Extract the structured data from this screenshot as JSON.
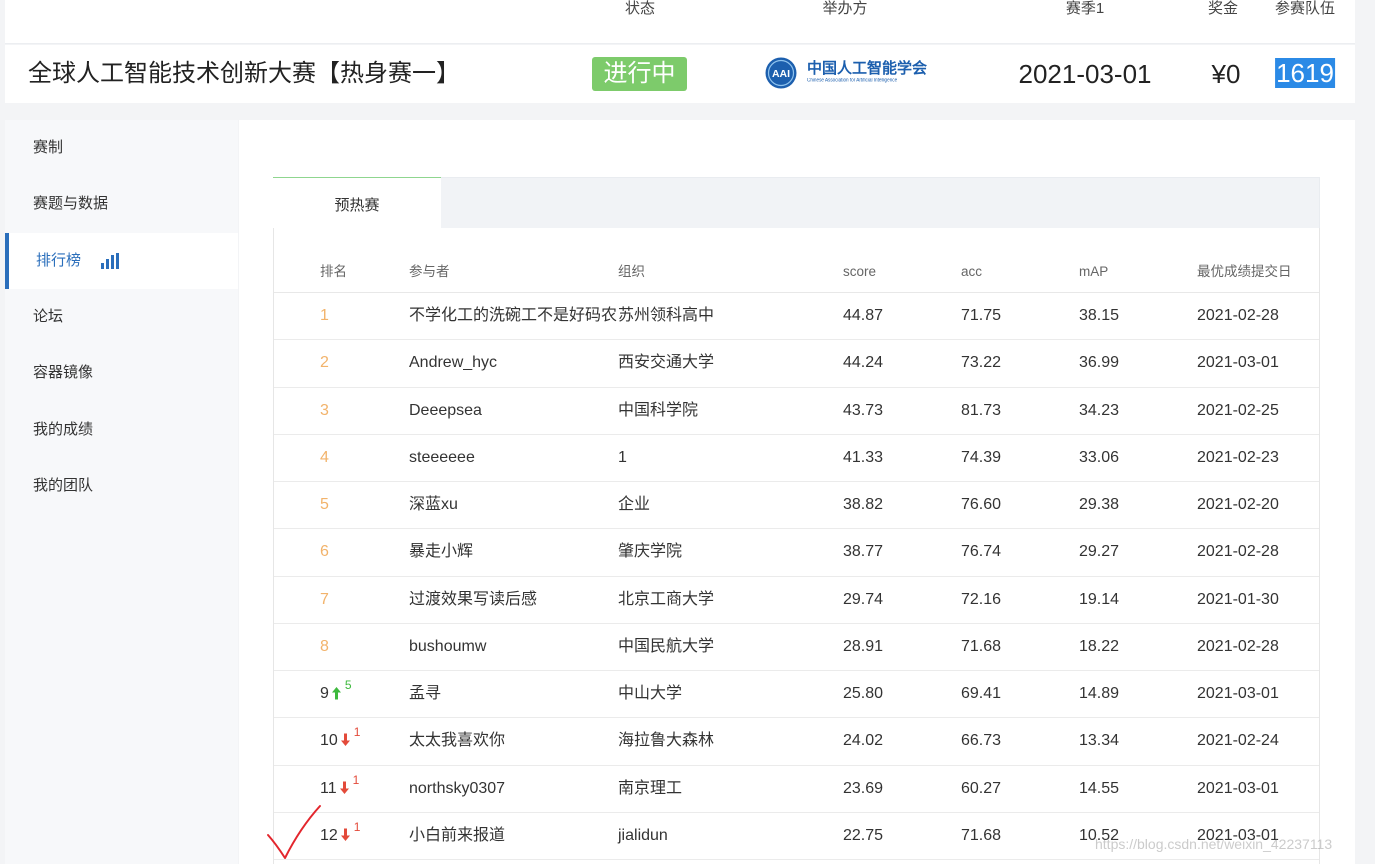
{
  "header": {
    "labels": {
      "status": "状态",
      "organizer": "举办方",
      "season": "赛季1",
      "prize": "奖金",
      "teams": "参赛队伍"
    },
    "title": "全球人工智能技术创新大赛【热身赛一】",
    "status": "进行中",
    "organizer": {
      "logo_icon": "caai-logo-icon",
      "logo_mark": "AAI",
      "name": "中国人工智能学会",
      "subtitle": "Chinese Association for Artificial Intelligence"
    },
    "season_date": "2021-03-01",
    "prize": "¥0",
    "teams": "1619"
  },
  "sidebar": {
    "items": [
      {
        "label": "赛制"
      },
      {
        "label": "赛题与数据"
      },
      {
        "label": "排行榜",
        "icon": "bar-chart-icon",
        "active": true
      },
      {
        "label": "论坛"
      },
      {
        "label": "容器镜像"
      },
      {
        "label": "我的成绩"
      },
      {
        "label": "我的团队"
      }
    ]
  },
  "tabs": [
    {
      "label": "预热赛",
      "active": true
    }
  ],
  "leaderboard": {
    "columns": [
      "排名",
      "参与者",
      "组织",
      "score",
      "acc",
      "mAP",
      "最优成绩提交日"
    ],
    "rows": [
      {
        "rank": "1",
        "highlighted": true,
        "participant": "不学化工的洗碗工不是好码农",
        "organization": "苏州领科高中",
        "score": "44.87",
        "acc": "71.75",
        "map": "38.15",
        "date": "2021-02-28"
      },
      {
        "rank": "2",
        "highlighted": true,
        "participant": "Andrew_hyc",
        "organization": "西安交通大学",
        "score": "44.24",
        "acc": "73.22",
        "map": "36.99",
        "date": "2021-03-01"
      },
      {
        "rank": "3",
        "highlighted": true,
        "participant": "Deeepsea",
        "organization": "中国科学院",
        "score": "43.73",
        "acc": "81.73",
        "map": "34.23",
        "date": "2021-02-25"
      },
      {
        "rank": "4",
        "highlighted": true,
        "participant": "steeeeee",
        "organization": "1",
        "score": "41.33",
        "acc": "74.39",
        "map": "33.06",
        "date": "2021-02-23"
      },
      {
        "rank": "5",
        "highlighted": true,
        "participant": "深蓝xu",
        "organization": "企业",
        "score": "38.82",
        "acc": "76.60",
        "map": "29.38",
        "date": "2021-02-20"
      },
      {
        "rank": "6",
        "highlighted": true,
        "participant": "暴走小辉",
        "organization": "肇庆学院",
        "score": "38.77",
        "acc": "76.74",
        "map": "29.27",
        "date": "2021-02-28"
      },
      {
        "rank": "7",
        "highlighted": true,
        "participant": "过渡效果写读后感",
        "organization": "北京工商大学",
        "score": "29.74",
        "acc": "72.16",
        "map": "19.14",
        "date": "2021-01-30"
      },
      {
        "rank": "8",
        "highlighted": true,
        "participant": "bushoumw",
        "organization": "中国民航大学",
        "score": "28.91",
        "acc": "71.68",
        "map": "18.22",
        "date": "2021-02-28"
      },
      {
        "rank": "9",
        "change": {
          "icon": "arrow-up-icon",
          "value": "5"
        },
        "participant": "孟寻",
        "organization": "中山大学",
        "score": "25.80",
        "acc": "69.41",
        "map": "14.89",
        "date": "2021-03-01"
      },
      {
        "rank": "10",
        "change": {
          "icon": "arrow-down-icon",
          "value": "1"
        },
        "participant": "太太我喜欢你",
        "organization": "海拉鲁大森林",
        "score": "24.02",
        "acc": "66.73",
        "map": "13.34",
        "date": "2021-02-24"
      },
      {
        "rank": "11",
        "change": {
          "icon": "arrow-down-icon",
          "value": "1"
        },
        "participant": "northsky0307",
        "organization": "南京理工",
        "score": "23.69",
        "acc": "60.27",
        "map": "14.55",
        "date": "2021-03-01"
      },
      {
        "rank": "12",
        "change": {
          "icon": "arrow-down-icon",
          "value": "1"
        },
        "participant": "小白前来报道",
        "organization": "jialidun",
        "score": "22.75",
        "acc": "71.68",
        "map": "10.52",
        "date": "2021-03-01"
      }
    ]
  },
  "watermark": "https://blog.csdn.net/weixin_42237113",
  "annotation": {
    "icon": "checkmark-icon"
  },
  "colors": {
    "accent": "#2a6ebb",
    "status_green": "#7dcb6b",
    "rank_highlight": "#f2b36b",
    "rank_up": "#3db93d",
    "rank_down": "#e34a3a",
    "selection": "#2b8ae6",
    "annotation": "#e3262d",
    "logo_blue": "#1c5fae"
  }
}
